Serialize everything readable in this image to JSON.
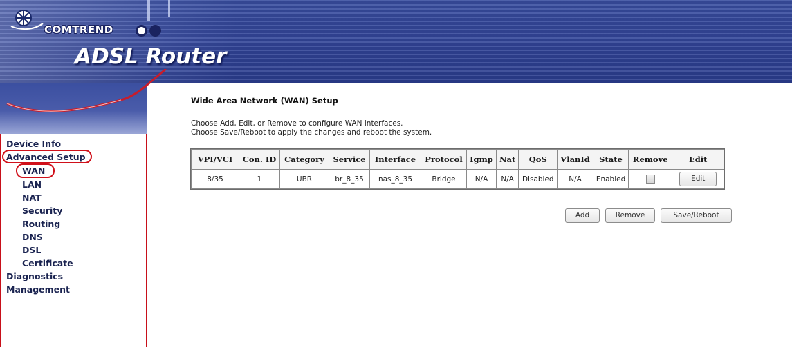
{
  "header": {
    "brand": "COMTREND",
    "product": "ADSL Router"
  },
  "sidebar": {
    "items": [
      {
        "label": "Device Info",
        "level": "top"
      },
      {
        "label": "Advanced Setup",
        "level": "top",
        "highlighted": true
      },
      {
        "label": "WAN",
        "level": "sub",
        "highlighted": true
      },
      {
        "label": "LAN",
        "level": "sub"
      },
      {
        "label": "NAT",
        "level": "sub"
      },
      {
        "label": "Security",
        "level": "sub"
      },
      {
        "label": "Routing",
        "level": "sub"
      },
      {
        "label": "DNS",
        "level": "sub"
      },
      {
        "label": "DSL",
        "level": "sub"
      },
      {
        "label": "Certificate",
        "level": "sub"
      },
      {
        "label": "Diagnostics",
        "level": "top"
      },
      {
        "label": "Management",
        "level": "top"
      }
    ]
  },
  "main": {
    "title": "Wide Area Network (WAN) Setup",
    "description_line1": "Choose Add, Edit, or Remove to configure WAN interfaces.",
    "description_line2": "Choose Save/Reboot to apply the changes and reboot the system.",
    "table": {
      "headers": [
        "VPI/VCI",
        "Con. ID",
        "Category",
        "Service",
        "Interface",
        "Protocol",
        "Igmp",
        "Nat",
        "QoS",
        "VlanId",
        "State",
        "Remove",
        "Edit"
      ],
      "rows": [
        {
          "vpi_vci": "8/35",
          "con_id": "1",
          "category": "UBR",
          "service": "br_8_35",
          "interface": "nas_8_35",
          "protocol": "Bridge",
          "igmp": "N/A",
          "nat": "N/A",
          "qos": "Disabled",
          "vlanid": "N/A",
          "state": "Enabled",
          "remove_checked": false,
          "edit_label": "Edit"
        }
      ]
    },
    "buttons": {
      "add": "Add",
      "remove": "Remove",
      "save_reboot": "Save/Reboot"
    }
  },
  "colors": {
    "header_blue": "#34479a",
    "sidebar_border": "#c8101a",
    "highlight_circle": "#d0101a",
    "nav_text": "#1a2350"
  }
}
